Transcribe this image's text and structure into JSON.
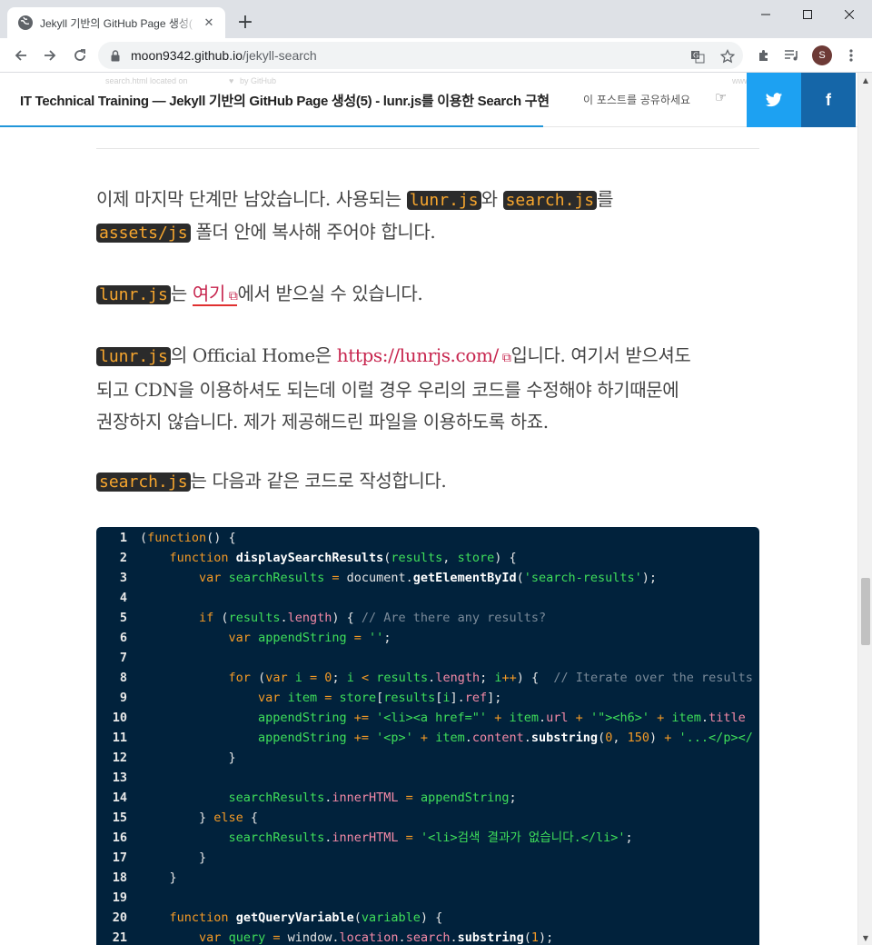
{
  "browser": {
    "tab_title": "Jekyll 기반의 GitHub Page 생성(",
    "new_tab": "+",
    "url_host": "moon9342.github.io",
    "url_path": "/jekyll-search"
  },
  "header": {
    "ghost_left": "search.html located on",
    "ghost_mid": "by GitHub",
    "ghost_right": "www.co",
    "post_title": "IT Technical Training — Jekyll 기반의 GitHub Page 생성(5) - lunr.js를 이용한 Search 구현",
    "share_label": "이 포스트를 공유하세요",
    "twitter": "t",
    "facebook": "f",
    "accent_color": "#2196d9"
  },
  "content": {
    "p1_a": "이제 마지막 단계만 남았습니다. 사용되는 ",
    "p1_code1": "lunr.js",
    "p1_b": "와 ",
    "p1_code2": "search.js",
    "p1_c": "를",
    "p1_code3": "assets/js",
    "p1_d": " 폴더 안에 복사해 주어야 합니다.",
    "p2_code": "lunr.js",
    "p2_a": "는 ",
    "p2_link": "여기",
    "p2_b": "에서 받으실 수 있습니다.",
    "p3_code": "lunr.js",
    "p3_a": "의 Official Home은 ",
    "p3_link": "https://lunrjs.com/",
    "p3_b": "입니다. 여기서 받으셔도",
    "p3_c": "되고 CDN을 이용하셔도 되는데 이럴 경우 우리의 코드를 수정해야 하기때문에",
    "p3_d": "권장하지 않습니다. 제가 제공해드린 파일을 이용하도록 하죠.",
    "p4_code": "search.js",
    "p4_a": "는 다음과 같은 코드로 작성합니다."
  },
  "code_lines": [
    {
      "n": "1",
      "html": "(<span class='kw'>function</span>() {"
    },
    {
      "n": "2",
      "html": "    <span class='kw'>function</span> <span class='fn'>displaySearchResults</span>(<span class='var'>results</span>, <span class='var'>store</span>) {"
    },
    {
      "n": "3",
      "html": "        <span class='kw'>var</span> <span class='var'>searchResults</span> <span class='kw'>=</span> document.<span class='fn'>getElementById</span>(<span class='str'>'search-results'</span>);"
    },
    {
      "n": "4",
      "html": ""
    },
    {
      "n": "5",
      "html": "        <span class='kw'>if</span> (<span class='var'>results</span>.<span class='pr'>length</span>) { <span class='cmt'>// Are there any results?</span>"
    },
    {
      "n": "6",
      "html": "            <span class='kw'>var</span> <span class='var'>appendString</span> <span class='kw'>=</span> <span class='str'>''</span>;"
    },
    {
      "n": "7",
      "html": ""
    },
    {
      "n": "8",
      "html": "            <span class='kw'>for</span> (<span class='kw'>var</span> <span class='var'>i</span> <span class='kw'>=</span> <span class='num'>0</span>; <span class='var'>i</span> <span class='kw'>&lt;</span> <span class='var'>results</span>.<span class='pr'>length</span>; <span class='var'>i</span><span class='kw'>++</span>) {  <span class='cmt'>// Iterate over the results</span>"
    },
    {
      "n": "9",
      "html": "                <span class='kw'>var</span> <span class='var'>item</span> <span class='kw'>=</span> <span class='var'>store</span>[<span class='var'>results</span>[<span class='var'>i</span>].<span class='pr'>ref</span>];"
    },
    {
      "n": "10",
      "html": "                <span class='var'>appendString</span> <span class='kw'>+=</span> <span class='str'>'&lt;li&gt;&lt;a href=\"'</span> <span class='kw'>+</span> <span class='var'>item</span>.<span class='pr'>url</span> <span class='kw'>+</span> <span class='str'>'\"&gt;&lt;h6&gt;'</span> <span class='kw'>+</span> <span class='var'>item</span>.<span class='pr'>title</span>"
    },
    {
      "n": "11",
      "html": "                <span class='var'>appendString</span> <span class='kw'>+=</span> <span class='str'>'&lt;p&gt;'</span> <span class='kw'>+</span> <span class='var'>item</span>.<span class='pr'>content</span>.<span class='fn'>substring</span>(<span class='num'>0</span>, <span class='num'>150</span>) <span class='kw'>+</span> <span class='str'>'...&lt;/p&gt;&lt;/</span>"
    },
    {
      "n": "12",
      "html": "            }"
    },
    {
      "n": "13",
      "html": ""
    },
    {
      "n": "14",
      "html": "            <span class='var'>searchResults</span>.<span class='pr'>innerHTML</span> <span class='kw'>=</span> <span class='var'>appendString</span>;"
    },
    {
      "n": "15",
      "html": "        } <span class='kw'>else</span> {"
    },
    {
      "n": "16",
      "html": "            <span class='var'>searchResults</span>.<span class='pr'>innerHTML</span> <span class='kw'>=</span> <span class='str'>'&lt;li&gt;검색 결과가 없습니다.&lt;/li&gt;'</span>;"
    },
    {
      "n": "17",
      "html": "        }"
    },
    {
      "n": "18",
      "html": "    }"
    },
    {
      "n": "19",
      "html": ""
    },
    {
      "n": "20",
      "html": "    <span class='kw'>function</span> <span class='fn'>getQueryVariable</span>(<span class='var'>variable</span>) {"
    },
    {
      "n": "21",
      "html": "        <span class='kw'>var</span> <span class='var'>query</span> <span class='kw'>=</span> window.<span class='pr'>location</span>.<span class='pr'>search</span>.<span class='fn'>substring</span>(<span class='num'>1</span>);"
    }
  ]
}
